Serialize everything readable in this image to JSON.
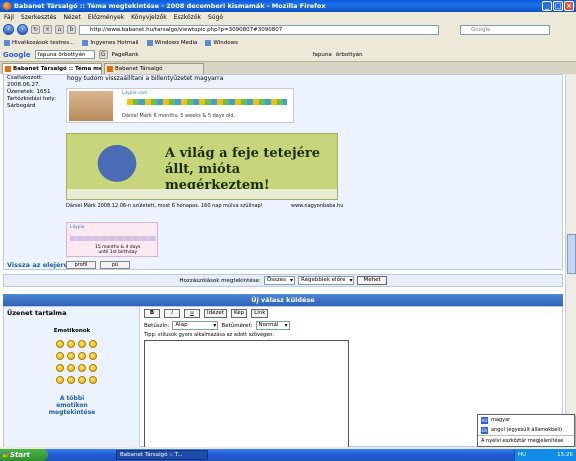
{
  "window": {
    "title": "Babanet Társalgó :: Téma megtekintése - 2008 decemberi kismamák - Mozilla Firefox"
  },
  "menu": [
    "Fájl",
    "Szerkesztés",
    "Nézet",
    "Előzmények",
    "Könyvjelzők",
    "Eszközök",
    "Súgó"
  ],
  "nav": {
    "url": "http://www.babanet.hu/tarsalgo/viewtopic.php?p=3090807#3090807",
    "search_placeholder": "Google"
  },
  "bookmarks": [
    "Hivatkozások testres...",
    "Ingyenes Hotmail",
    "Windows Media",
    "Windows"
  ],
  "googlebar": {
    "logo": "Google",
    "query": "fapuna örbottyán",
    "pagerank": "PageRank",
    "word1": "fapuna",
    "word2": "örbottyán"
  },
  "tabs": [
    "Babanet Társalgó :: Téma megte...",
    "Babanet Társalgó"
  ],
  "post": {
    "user_info": [
      "Csatlakozott:",
      "2008.06.27.",
      "Üzenetek: 1651",
      "Tartózkodási hely:",
      "Sárbogárd"
    ],
    "text": "hogy tudom visszaállítani a billentyűzetet magyarra",
    "sig1_caption": "Dániel Márk 6 months, 5 weeks & 5 days old.",
    "sig1_site": "Lilypie.com",
    "sig2_slogan": "A világ a feje tetejére állt, mióta megérkeztem!",
    "sig3_text": "Dániel Márk 2008.12.06-n született, most 6 hónapos. 160 nap múlva szülinap!",
    "sig3_site": "www.nagyonbaba.hu",
    "sig4_site": "Lilypie",
    "sig4_text": [
      "15 months & 4 days",
      "until 1st birthday"
    ],
    "back_to_top": "Vissza az elejére",
    "profile_btn": "profil",
    "pm_btn": "pü"
  },
  "sort": {
    "label": "Hozzászólások megtekintése:",
    "filter": "Összes",
    "order": "Régebbiek előre",
    "go": "Mehet"
  },
  "reply": {
    "header": "Új válasz küldése",
    "body_label": "Üzenet tartalma",
    "emoticons_label": "Emotikonok",
    "more_emoticons": [
      "A többi",
      "emotikon",
      "megtekintése"
    ],
    "tools": [
      "B",
      "i",
      "u",
      "Idézet",
      "Kép",
      "Link"
    ],
    "font_color_label": "Betűszín:",
    "font_color": "Alap",
    "font_size_label": "Betűméret:",
    "font_size": "Normál",
    "tip": "Tipp: stílusok gyors alkalmazása az adott szövegen."
  },
  "language_popup": {
    "items": [
      {
        "code": "HU",
        "label": "magyar"
      },
      {
        "code": "EN",
        "label": "angol (egyesült államokbeli)"
      }
    ],
    "footer": "A nyelvi eszköztár megjelenítése"
  },
  "taskbar": {
    "start": "Start",
    "item": "Babanet Társalgó :: T...",
    "lang": "HU",
    "clock": "15:26"
  }
}
